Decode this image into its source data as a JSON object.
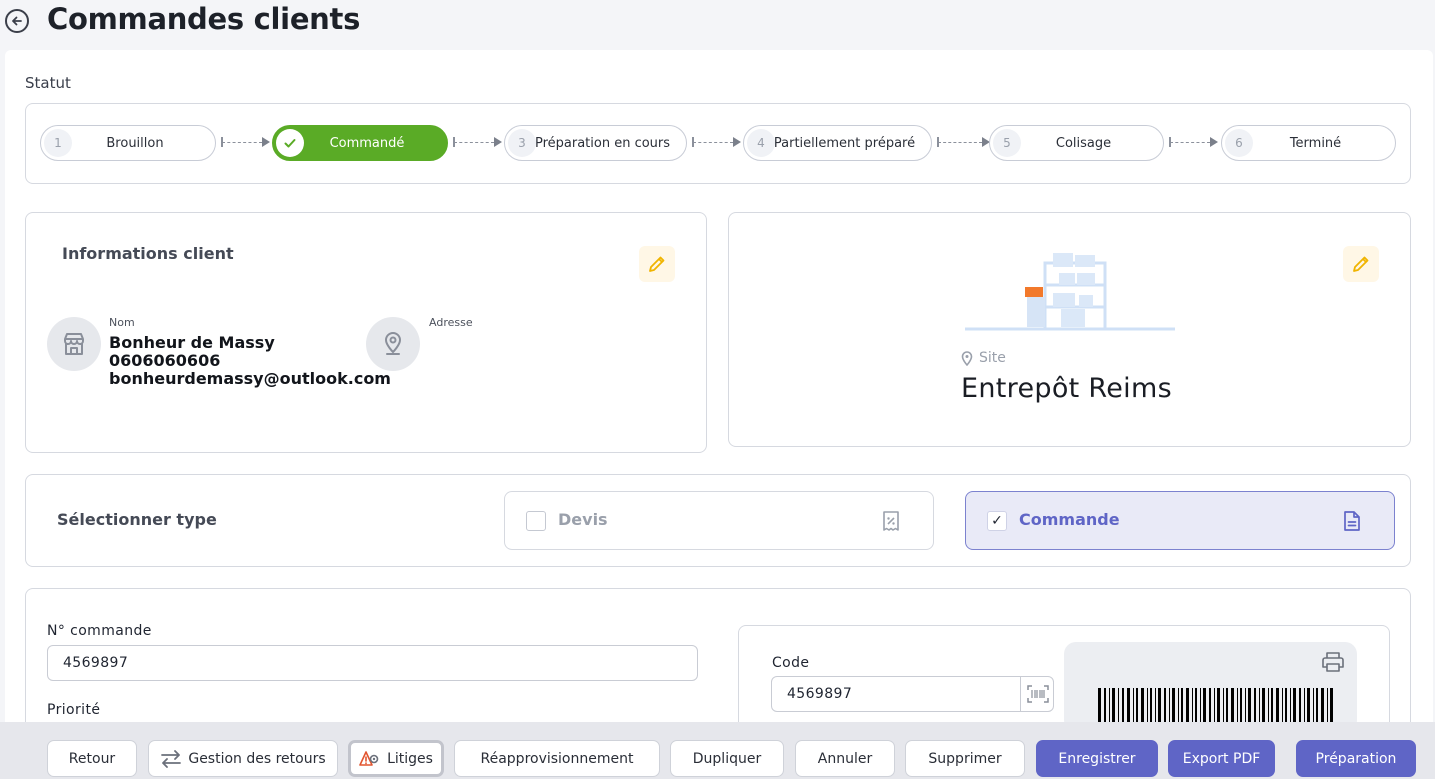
{
  "header": {
    "title": "Commandes clients"
  },
  "status": {
    "label": "Statut",
    "steps": [
      {
        "num": "1",
        "label": "Brouillon"
      },
      {
        "num": "",
        "label": "Commandé"
      },
      {
        "num": "3",
        "label": "Préparation en cours"
      },
      {
        "num": "4",
        "label": "Partiellement préparé"
      },
      {
        "num": "5",
        "label": "Colisage"
      },
      {
        "num": "6",
        "label": "Terminé"
      }
    ],
    "active_step": "Commandé"
  },
  "client": {
    "title": "Informations client",
    "name_label": "Nom",
    "name": "Bonheur de Massy",
    "phone": "0606060606",
    "email": "bonheurdemassy@outlook.com",
    "address_label": "Adresse"
  },
  "site": {
    "label": "Site",
    "name": "Entrepôt Reims"
  },
  "type_select": {
    "label": "Sélectionner type",
    "options": [
      {
        "label": "Devis",
        "checked": false
      },
      {
        "label": "Commande",
        "checked": true
      }
    ],
    "check_mark": "✓"
  },
  "order": {
    "number_label": "N° commande",
    "number_value": "4569897",
    "priority_label": "Priorité",
    "code_label": "Code",
    "code_value": "4569897"
  },
  "actions": {
    "retour": "Retour",
    "gestion_retours": "Gestion des retours",
    "litiges": "Litiges",
    "reappro": "Réapprovisionnement",
    "dupliquer": "Dupliquer",
    "annuler": "Annuler",
    "supprimer": "Supprimer",
    "enregistrer": "Enregistrer",
    "export_pdf": "Export PDF",
    "preparation": "Préparation"
  },
  "colors": {
    "active_step": "#5aab26",
    "primary": "#5f65c6",
    "edit_icon": "#f0b400",
    "selected_type_bg": "#e9eaf7"
  },
  "icons": {
    "back": "arrow-left-circle-icon",
    "edit": "pencil-icon",
    "store": "store-icon",
    "location": "map-pin-icon",
    "percent_doc": "receipt-percent-icon",
    "document": "document-icon",
    "barcode_scan": "barcode-scan-icon",
    "print": "printer-icon",
    "swap": "swap-arrows-icon",
    "dispute": "warning-gear-icon"
  }
}
